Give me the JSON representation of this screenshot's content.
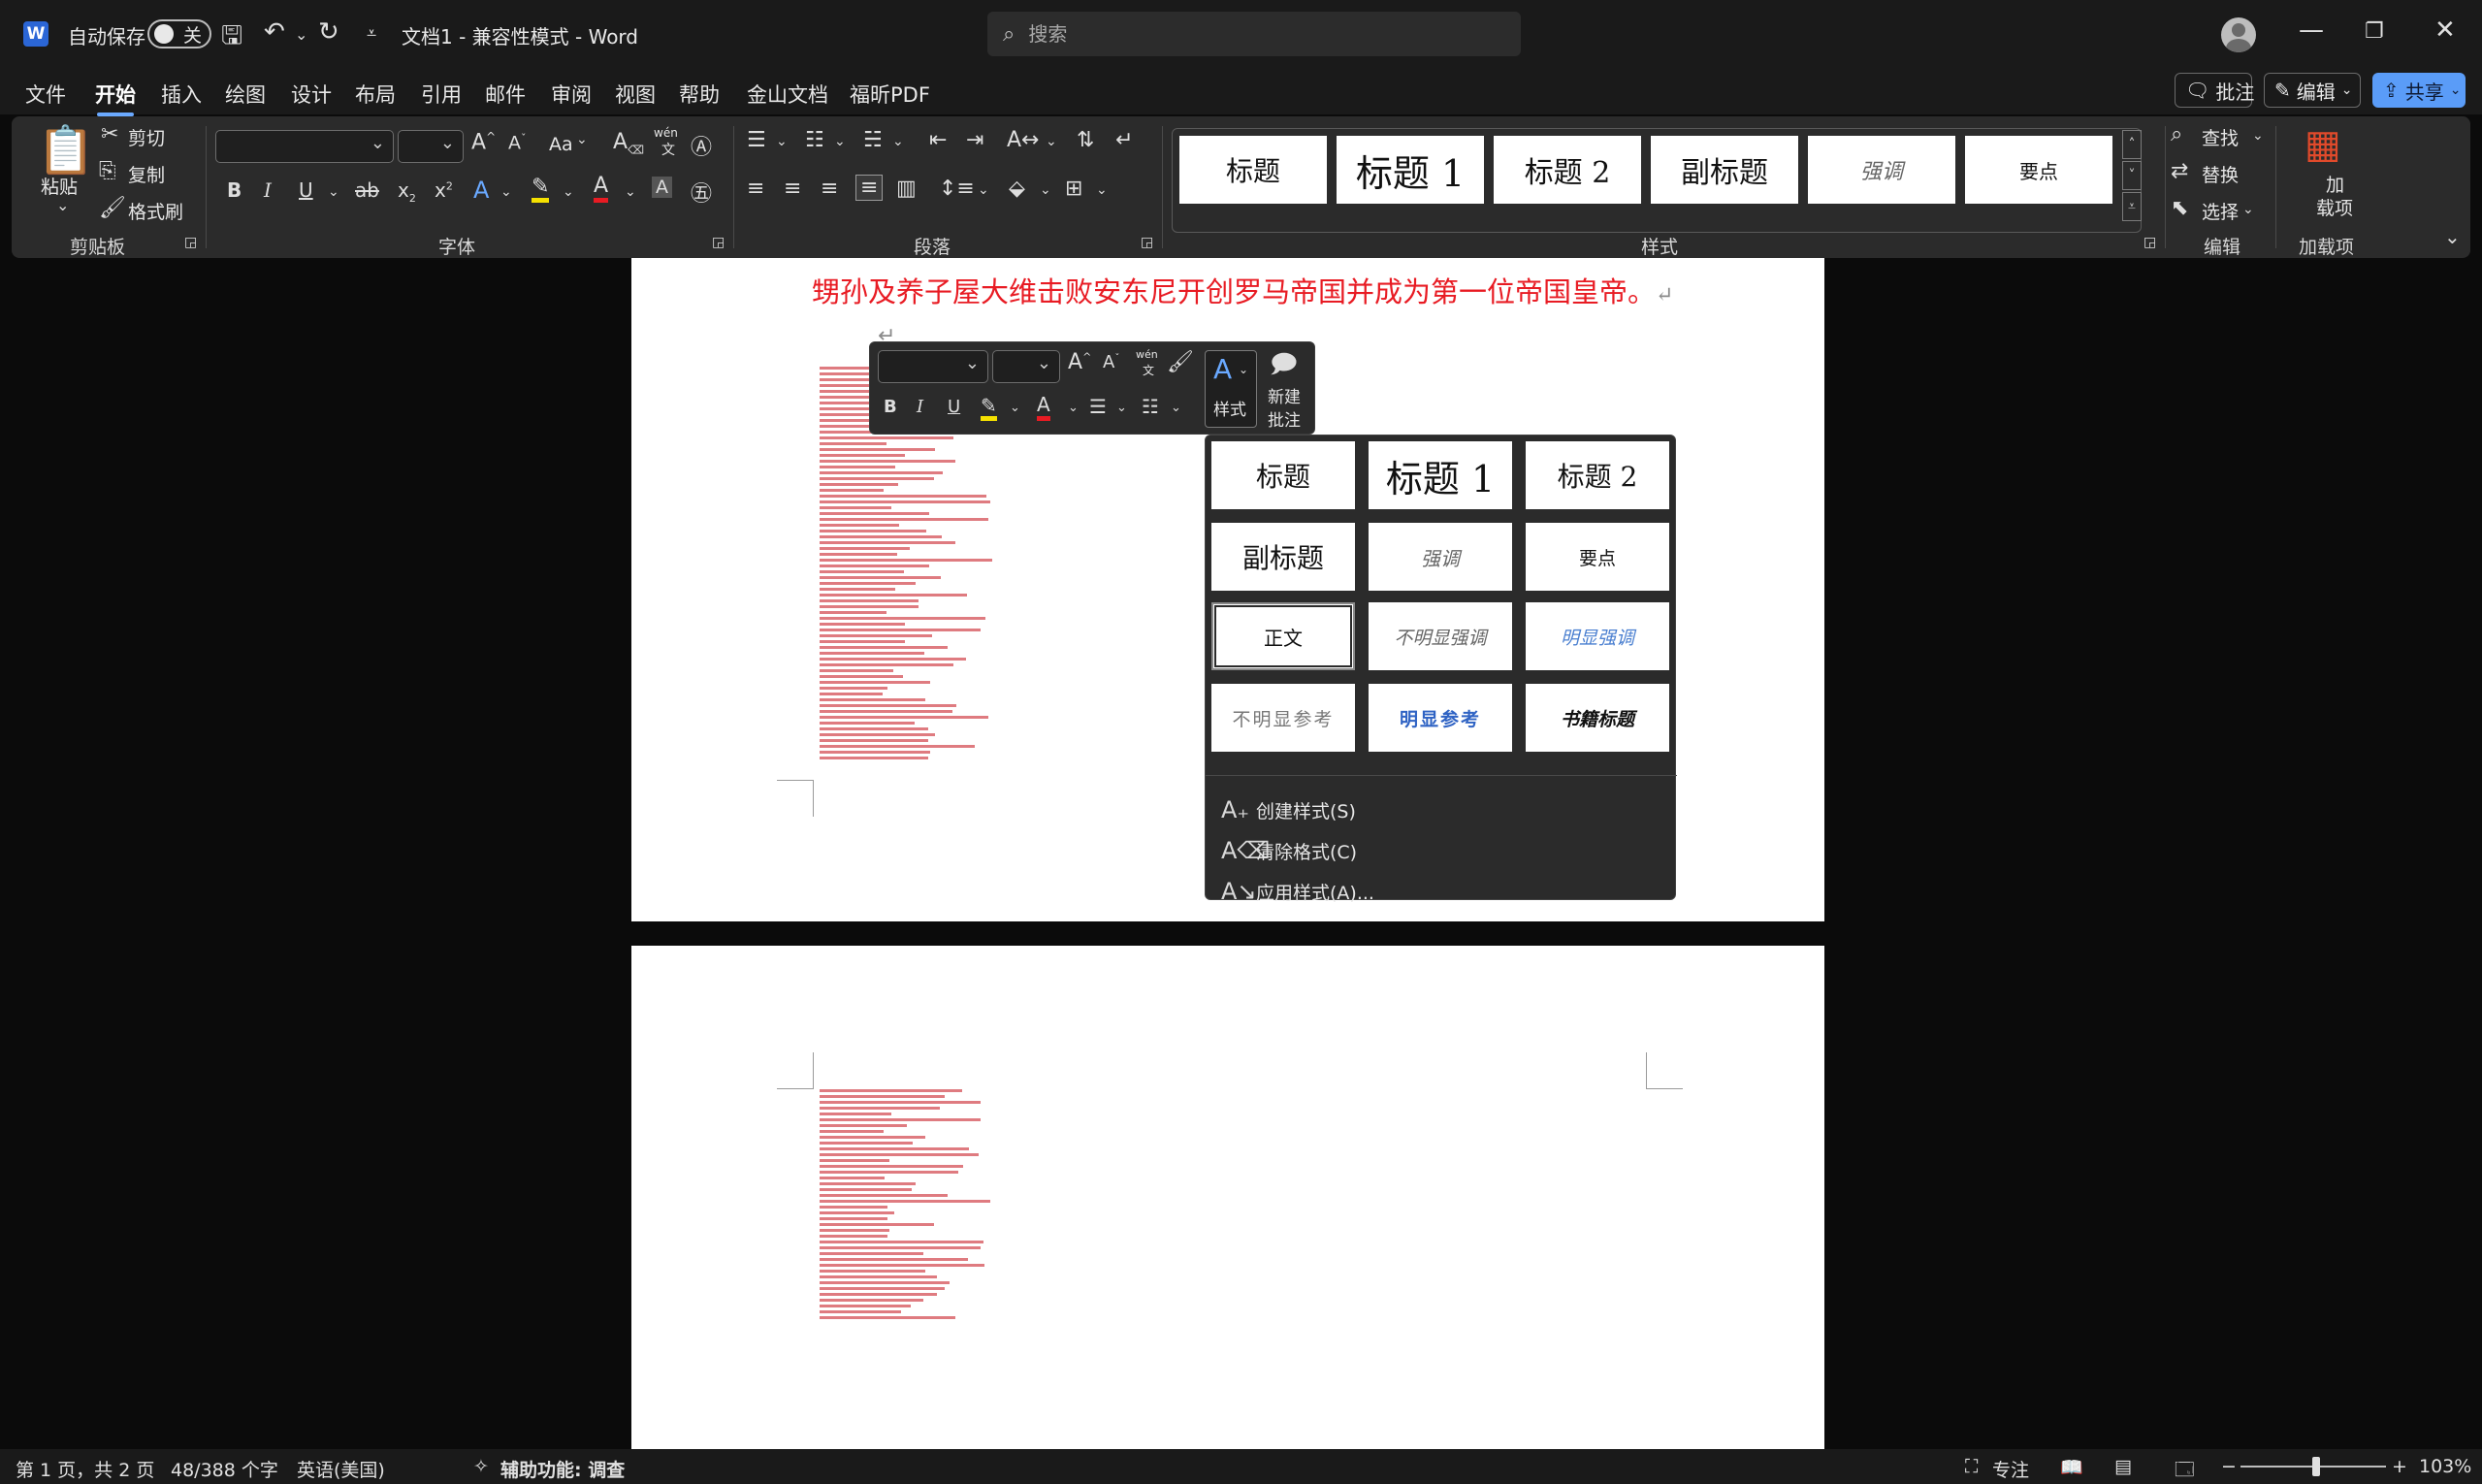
{
  "titlebar": {
    "app_letter": "W",
    "autosave_label": "自动保存",
    "autosave_state": "关",
    "doc_title": "文档1  -  兼容性模式  -  Word",
    "search_placeholder": "搜索"
  },
  "menu": {
    "tabs": [
      "文件",
      "开始",
      "插入",
      "绘图",
      "设计",
      "布局",
      "引用",
      "邮件",
      "审阅",
      "视图",
      "帮助",
      "金山文档",
      "福昕PDF"
    ],
    "active_tab": "开始",
    "comments": "批注",
    "edit": "编辑",
    "share": "共享"
  },
  "ribbon": {
    "clipboard": {
      "paste": "粘贴",
      "cut": "剪切",
      "copy": "复制",
      "format_painter": "格式刷",
      "label": "剪贴板"
    },
    "font": {
      "label": "字体",
      "wen_top": "wén",
      "wen_bottom": "文",
      "aa": "Aa"
    },
    "paragraph": {
      "label": "段落"
    },
    "styles": {
      "label": "样式",
      "cards": [
        "标题",
        "标题 1",
        "标题 2",
        "副标题",
        "强调",
        "要点"
      ]
    },
    "editing": {
      "find": "查找",
      "replace": "替换",
      "select": "选择",
      "label": "编辑"
    },
    "addins": {
      "line1": "加",
      "line2": "载项",
      "label": "加载项"
    }
  },
  "document": {
    "red_line": "甥孙及养子屋大维击败安东尼开创罗马帝国并成为第一位帝国皇帝。",
    "para_mark": "↵"
  },
  "mini_toolbar": {
    "style_label": "样式",
    "new_comment_1": "新建",
    "new_comment_2": "批注",
    "wen_top": "wén",
    "wen_bottom": "文"
  },
  "styles_dropdown": {
    "cards": [
      "标题",
      "标题 1",
      "标题 2",
      "副标题",
      "强调",
      "要点",
      "正文",
      "不明显强调",
      "明显强调",
      "不明显参考",
      "明显参考",
      "书籍标题"
    ],
    "actions": [
      "创建样式(S)",
      "清除格式(C)",
      "应用样式(A)..."
    ]
  },
  "status": {
    "page": "第 1 页，共 2 页",
    "words": "48/388 个字",
    "language": "英语(美国)",
    "accessibility": "辅助功能: 调查",
    "focus": "专注",
    "zoom": "103%"
  },
  "colors": {
    "accent": "#5a9cf8",
    "doc_red": "#e81b23",
    "emphasis_blue": "#4a7fd0"
  }
}
